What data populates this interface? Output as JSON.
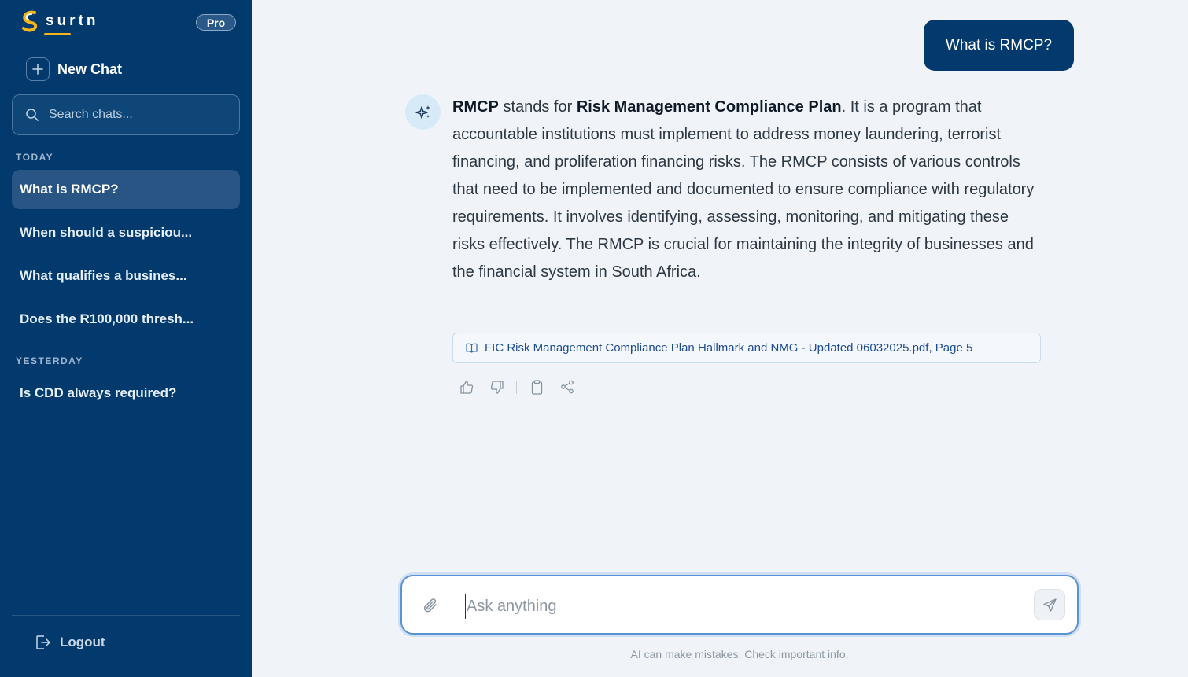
{
  "sidebar": {
    "brand": "surtn",
    "badge": "Pro",
    "new_chat_label": "New Chat",
    "search_placeholder": "Search chats...",
    "sections": [
      {
        "label": "TODAY",
        "items": [
          "What is RMCP?",
          "When should a suspiciou...",
          "What qualifies a busines...",
          "Does the R100,000 thresh..."
        ]
      },
      {
        "label": "YESTERDAY",
        "items": [
          "Is CDD always required?"
        ]
      }
    ],
    "logout_label": "Logout"
  },
  "conversation": {
    "user_message": "What is RMCP?",
    "answer": {
      "term": "RMCP",
      "connector": " stands for ",
      "expansion": "Risk Management Compliance Plan",
      "body": ". It is a program that accountable institutions must implement to address money laundering, terrorist financing, and proliferation financing risks. The RMCP consists of various controls that need to be implemented and documented to ensure compliance with regulatory requirements. It involves identifying, assessing, monitoring, and mitigating these risks effectively. The RMCP is crucial for maintaining the integrity of businesses and the financial system in South Africa."
    },
    "source": "FIC Risk Management Compliance Plan Hallmark and NMG - Updated 06032025.pdf, Page 5"
  },
  "composer": {
    "placeholder": "Ask anything",
    "value": "",
    "disclaimer": "AI can make mistakes. Check important info."
  },
  "colors": {
    "sidebar_bg": "#033a6d",
    "accent": "#f5b51c",
    "main_bg": "#f0f4f9"
  }
}
